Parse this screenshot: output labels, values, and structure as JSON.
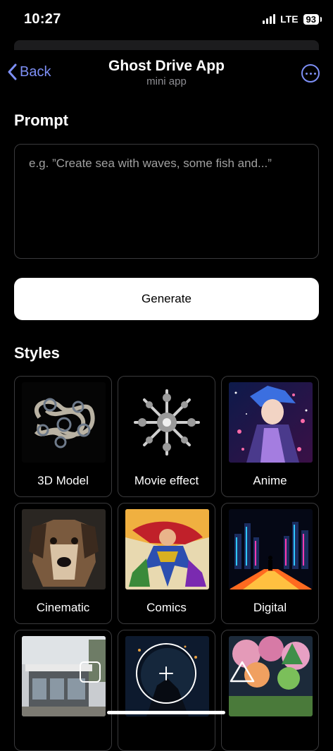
{
  "status_bar": {
    "time": "10:27",
    "network": "LTE",
    "battery": "93"
  },
  "nav": {
    "back_label": "Back",
    "title": "Ghost Drive App",
    "subtitle": "mini app",
    "more_icon": "ellipsis-circle-icon"
  },
  "prompt": {
    "heading": "Prompt",
    "value": "",
    "placeholder": "e.g. ”Create sea with waves, some fish and...”"
  },
  "generate_label": "Generate",
  "styles": {
    "heading": "Styles",
    "items": [
      {
        "label": "3D Model"
      },
      {
        "label": "Movie effect"
      },
      {
        "label": "Anime"
      },
      {
        "label": "Cinematic"
      },
      {
        "label": "Comics"
      },
      {
        "label": "Digital"
      },
      {
        "label": ""
      },
      {
        "label": ""
      },
      {
        "label": ""
      }
    ]
  },
  "tab_bar": {
    "icons": [
      "square-icon",
      "plus-icon",
      "triangle-icon"
    ]
  },
  "colors": {
    "accent": "#7d8ff5",
    "background": "#000000",
    "card_border": "#3a3a3c"
  }
}
